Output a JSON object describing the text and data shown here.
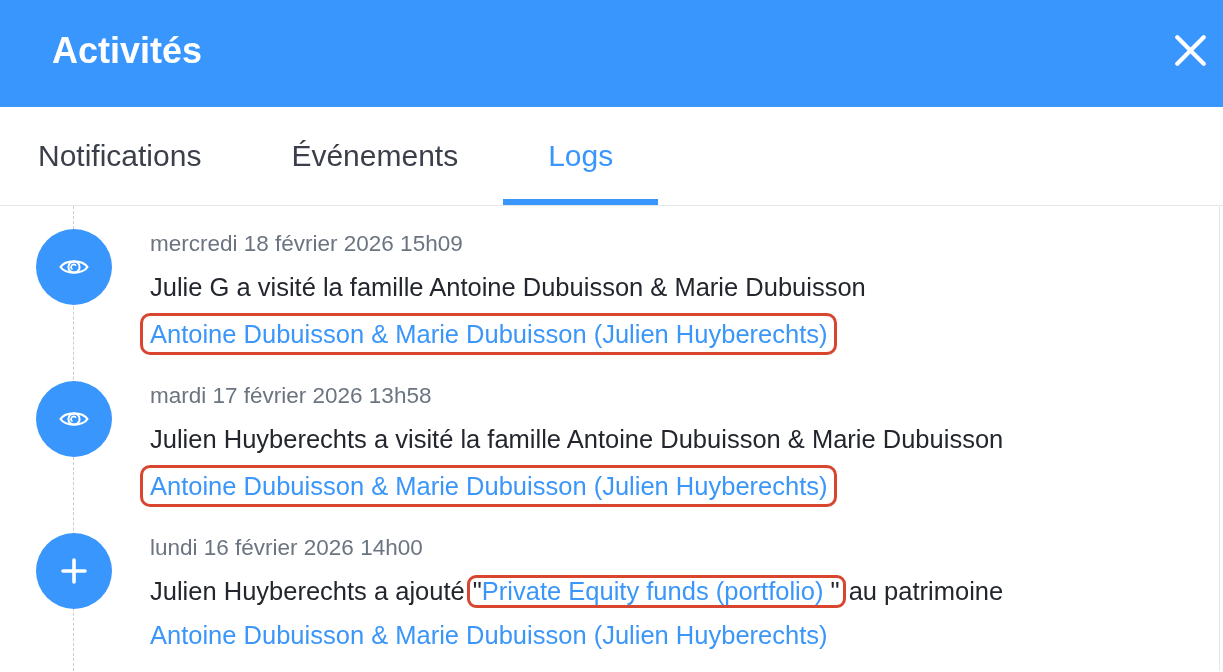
{
  "header": {
    "title": "Activités"
  },
  "tabs": [
    {
      "label": "Notifications",
      "selected": false
    },
    {
      "label": "Événements",
      "selected": false
    },
    {
      "label": "Logs",
      "selected": true
    }
  ],
  "logs": [
    {
      "kind": "visit",
      "date": "mercredi 18 février 2026 15h09",
      "description": [
        {
          "kind": "text",
          "text": "Julie G a visité la famille Antoine Dubuisson & Marie Dubuisson"
        }
      ],
      "family_link": {
        "text": "Antoine Dubuisson & Marie Dubuisson (Julien Huyberechts)",
        "highlighted": true
      }
    },
    {
      "kind": "visit",
      "date": "mardi 17 février 2026 13h58",
      "description": [
        {
          "kind": "text",
          "text": "Julien Huyberechts a visité la famille Antoine Dubuisson & Marie Dubuisson"
        }
      ],
      "family_link": {
        "text": "Antoine Dubuisson & Marie Dubuisson (Julien Huyberechts)",
        "highlighted": true
      }
    },
    {
      "kind": "add",
      "date": "lundi 16 février 2026 14h00",
      "description": [
        {
          "kind": "text",
          "text": "Julien Huyberechts a ajouté "
        },
        {
          "kind": "quoted_link",
          "open_quote": "\"",
          "text": "Private Equity funds (portfolio) ",
          "close_quote": "\"",
          "highlighted": true
        },
        {
          "kind": "text",
          "text": " au patrimoine"
        }
      ],
      "family_link": {
        "text": "Antoine Dubuisson & Marie Dubuisson (Julien Huyberechts)",
        "highlighted": false
      }
    }
  ]
}
